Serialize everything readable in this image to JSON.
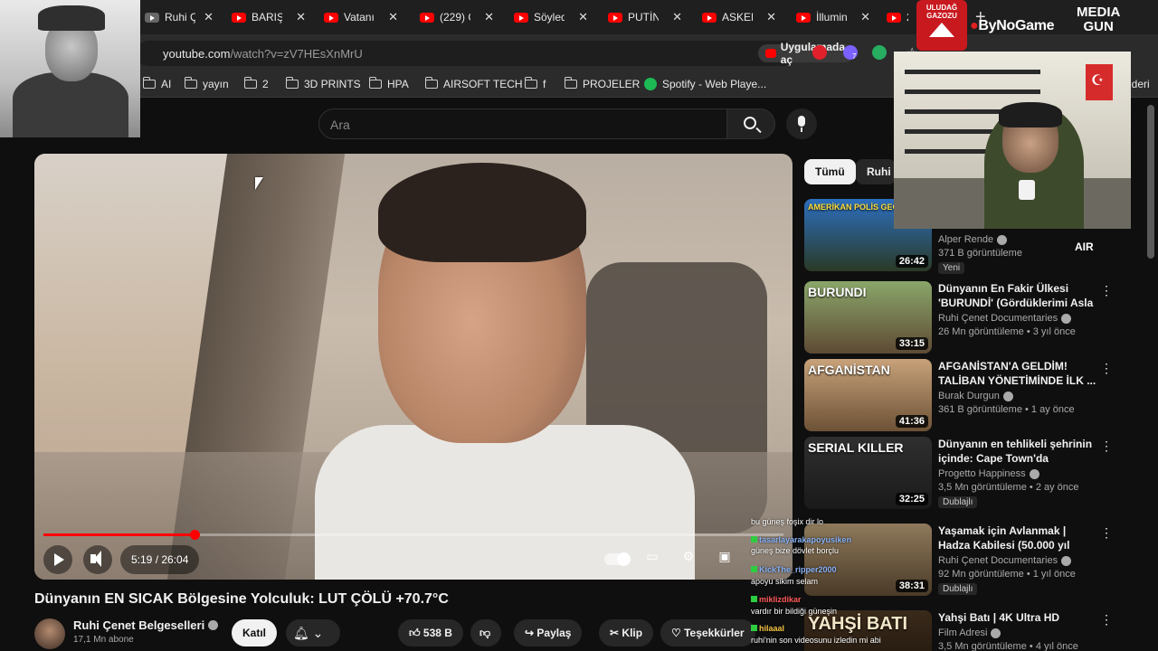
{
  "browser": {
    "tabs": [
      {
        "label": "Ruhi Çe"
      },
      {
        "label": "BARIŞ P"
      },
      {
        "label": "Vatanın"
      },
      {
        "label": "(229) O"
      },
      {
        "label": "Söyledi"
      },
      {
        "label": "PUTİN'"
      },
      {
        "label": "ASKER"
      },
      {
        "label": "İllumin"
      },
      {
        "label": "20"
      }
    ],
    "url_host": "youtube.com",
    "url_path": "/watch?v=zV7HEsXnMrU",
    "open_in_app_label": "Uygulamada aç",
    "extension_badge": "7",
    "bookmarks": [
      {
        "label": "AI",
        "icon": "folder-icon"
      },
      {
        "label": "yayın",
        "icon": "folder-icon"
      },
      {
        "label": "2",
        "icon": "folder-icon"
      },
      {
        "label": "3D PRINTS",
        "icon": "folder-icon"
      },
      {
        "label": "HPA",
        "icon": "folder-icon"
      },
      {
        "label": "AIRSOFT TECH",
        "icon": "folder-icon"
      },
      {
        "label": "f",
        "icon": "folder-icon"
      },
      {
        "label": "PROJELER",
        "icon": "folder-icon"
      },
      {
        "label": "Spotify - Web Playe...",
        "icon": "spotify-icon"
      }
    ],
    "bookmarks_more": "lderi"
  },
  "youtube": {
    "search_placeholder": "Ara",
    "player": {
      "current_time": "5:19",
      "duration": "26:04",
      "time_display": "5:19 / 26:04",
      "progress_fraction": 0.204
    },
    "video": {
      "title": "Dünyanın EN SICAK Bölgesine Yolculuk: LUT ÇÖLÜ +70.7°C",
      "channel": "Ruhi Çenet Belgeselleri",
      "subscribers": "17,1 Mn abone",
      "join_label": "Katıl",
      "likes": "538 B",
      "share_label": "Paylaş",
      "clip_label": "Klip",
      "thanks_label": "Teşekkürler"
    },
    "chips": [
      {
        "label": "Tümü",
        "active": true
      },
      {
        "label": "Ruhi Ç",
        "active": false
      }
    ],
    "recommendations": [
      {
        "thumb_text": "AMERİKAN POLİS GECE DEVRİYESİ",
        "duration": "26:42",
        "title": "",
        "channel": "Alper Rende",
        "views": "371 B görüntüleme",
        "age": "",
        "badge": "Yeni"
      },
      {
        "thumb_text": "BURUNDI",
        "duration": "33:15",
        "title": "Dünyanın En Fakir Ülkesi 'BURUNDİ' (Gördüklerimi Asla ...",
        "channel": "Ruhi Çenet Documentaries",
        "views": "26 Mn görüntüleme",
        "age": "3 yıl önce",
        "badge": ""
      },
      {
        "thumb_text": "AFGANİSTAN",
        "duration": "41:36",
        "title": "AFGANİSTAN'A GELDİM! TALİBAN YÖNETİMİNDE İLK ...",
        "channel": "Burak Durgun",
        "views": "361 B görüntüleme",
        "age": "1 ay önce",
        "badge": ""
      },
      {
        "thumb_text": "SERIAL KILLER",
        "duration": "32:25",
        "title": "Dünyanın en tehlikeli şehrinin içinde: Cape Town'da yaşamak...",
        "channel": "Progetto Happiness",
        "views": "3,5 Mn görüntüleme",
        "age": "2 ay önce",
        "badge": "Dublajlı"
      },
      {
        "thumb_text": "",
        "duration": "38:31",
        "title": "Yaşamak için Avlanmak | Hadza Kabilesi (50.000 yıl boyunca ...",
        "channel": "Ruhi Çenet Documentaries",
        "views": "92 Mn görüntüleme",
        "age": "1 yıl önce",
        "badge": "Dublajlı"
      },
      {
        "thumb_text": "YAHŞİ BATI",
        "duration": "",
        "title": "Yahşi Batı | 4K Ultra HD",
        "channel": "Film Adresi",
        "views": "3,5 Mn görüntüleme",
        "age": "4 yıl önce",
        "badge": ""
      }
    ]
  },
  "overlays": {
    "sponsor_logo_text": "ULUDAĞ GAZOZU",
    "sponsor_2": "ByNoGame",
    "sponsor_3_line1": "MEDIA",
    "sponsor_3_line2": "GUN",
    "cam_caption": "AIR",
    "chat": [
      {
        "user": "",
        "message": "bu güneş foşix dir lo",
        "color": "#ffffff"
      },
      {
        "user": "tasarlayarakapoyusiken",
        "message": "güneş bize dövlet borçlu",
        "color": "#8ab4f8"
      },
      {
        "user": "KickThe_ripper2000",
        "message": "apoyu sikim selam",
        "color": "#8ab4f8"
      },
      {
        "user": "miklizdikar",
        "message": "vardır bir bildiği güneşin",
        "color": "#ff5a5a"
      },
      {
        "user": "hilaaal",
        "message": "ruhi'nin son videosunu izledin mi abi",
        "color": "#f5c542"
      }
    ]
  }
}
